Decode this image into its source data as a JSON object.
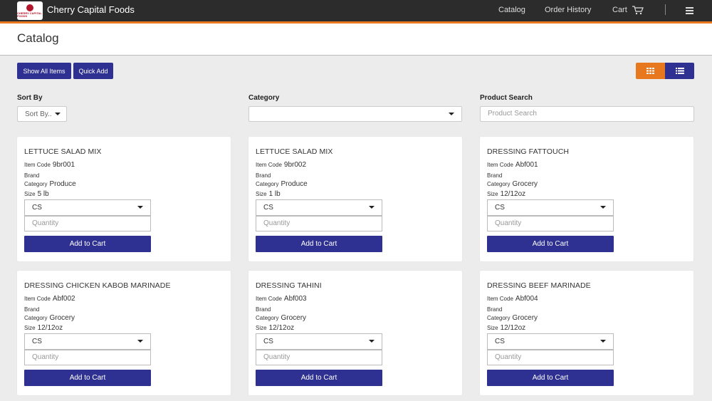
{
  "app": {
    "brand_name": "Cherry Capital Foods",
    "logo_text": "CHERRY CAPITAL FOODS"
  },
  "nav": {
    "catalog": "Catalog",
    "order_history": "Order History",
    "cart": "Cart"
  },
  "page": {
    "title": "Catalog"
  },
  "toolbar": {
    "show_all_items": "Show All Items",
    "quick_add": "Quick Add"
  },
  "filters": {
    "sort_label": "Sort By",
    "sort_value": "Sort By..",
    "category_label": "Category",
    "category_value": "",
    "search_label": "Product Search",
    "search_placeholder": "Product Search"
  },
  "labels": {
    "item_code": "Item Code",
    "brand": "Brand",
    "category": "Category",
    "size": "Size",
    "quantity_placeholder": "Quantity",
    "add_to_cart": "Add to Cart"
  },
  "products": [
    {
      "name": "LETTUCE SALAD MIX",
      "item_code": "9br001",
      "brand": "",
      "category": "Produce",
      "size": "5 lb",
      "uom": "CS"
    },
    {
      "name": "LETTUCE SALAD MIX",
      "item_code": "9br002",
      "brand": "",
      "category": "Produce",
      "size": "1 lb",
      "uom": "CS"
    },
    {
      "name": "DRESSING FATTOUCH",
      "item_code": "Abf001",
      "brand": "",
      "category": "Grocery",
      "size": "12/12oz",
      "uom": "CS"
    },
    {
      "name": "DRESSING CHICKEN KABOB MARINADE",
      "item_code": "Abf002",
      "brand": "",
      "category": "Grocery",
      "size": "12/12oz",
      "uom": "CS"
    },
    {
      "name": "DRESSING TAHINI",
      "item_code": "Abf003",
      "brand": "",
      "category": "Grocery",
      "size": "12/12oz",
      "uom": "CS"
    },
    {
      "name": "DRESSING BEEF MARINADE",
      "item_code": "Abf004",
      "brand": "",
      "category": "Grocery",
      "size": "12/12oz",
      "uom": "CS"
    }
  ],
  "colors": {
    "navbar": "#2c2c2c",
    "accent_orange": "#e8781e",
    "primary_blue": "#2e3192",
    "background": "#ececec"
  },
  "icons": {
    "cart": "cart-icon",
    "menu": "hamburger-menu-icon",
    "grid_view": "grid-view-icon",
    "list_view": "list-view-icon"
  }
}
